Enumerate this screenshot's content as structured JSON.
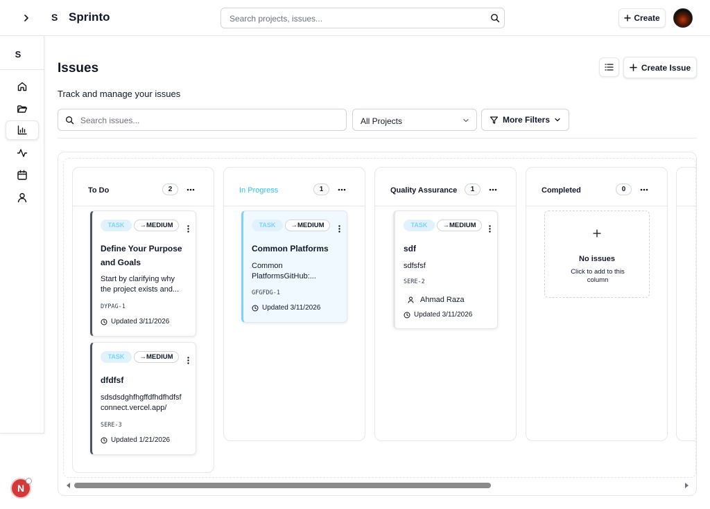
{
  "topbar": {
    "logo_letter": "S",
    "brand": "Sprinto",
    "search_placeholder": "Search projects, issues...",
    "create_label": "Create"
  },
  "sidebar": {
    "logo_letter": "S",
    "items": [
      {
        "icon": "home-icon"
      },
      {
        "icon": "folder-icon"
      },
      {
        "icon": "bar-chart-icon",
        "active": true
      },
      {
        "icon": "activity-icon"
      },
      {
        "icon": "calendar-icon"
      },
      {
        "icon": "user-icon"
      }
    ],
    "badge_letter": "N"
  },
  "page": {
    "title": "Issues",
    "subtitle": "Track and manage your issues",
    "create_issue_label": "Create Issue"
  },
  "filters": {
    "search_placeholder": "Search issues...",
    "project_select": "All Projects",
    "more_filters_label": "More Filters"
  },
  "board": {
    "columns": [
      {
        "title": "To Do",
        "count": "2",
        "cards": [
          {
            "type": "TASK",
            "priority": "→MEDIUM",
            "title_lines": [
              "Define Your Purpose",
              "and Goals"
            ],
            "desc_lines": [
              "Start by clarifying why",
              "the project exists and..."
            ],
            "key": "DYPAG-1",
            "updated": "Updated 3/11/2026"
          },
          {
            "type": "TASK",
            "priority": "→MEDIUM",
            "title_lines": [
              "dfdfsf"
            ],
            "desc_lines": [
              "sdsdsdghfhgffdfhdfhdfsf",
              "connect.vercel.app/"
            ],
            "key": "SERE-3",
            "updated": "Updated 1/21/2026"
          }
        ]
      },
      {
        "title": "In Progress",
        "count": "1",
        "cards": [
          {
            "type": "TASK",
            "priority": "→MEDIUM",
            "title_lines": [
              "Common Platforms"
            ],
            "desc_lines": [
              "Common",
              "PlatformsGitHub:..."
            ],
            "key": "GFGFDG-1",
            "updated": "Updated 3/11/2026"
          }
        ]
      },
      {
        "title": "Quality Assurance",
        "count": "1",
        "cards": [
          {
            "type": "TASK",
            "priority": "→MEDIUM",
            "title_lines": [
              "sdf"
            ],
            "desc_lines": [
              "sdfsfsf"
            ],
            "key": "SERE-2",
            "assignee": "Ahmad Raza",
            "updated": "Updated 3/11/2026"
          }
        ]
      },
      {
        "title": "Completed",
        "count": "0",
        "empty_title": "No issues",
        "empty_sub": "Click to add to this column"
      }
    ]
  },
  "colors": {
    "in_progress_title": "#38bdf8",
    "task_tag_bg": "#e0f2fe",
    "task_tag_text": "#7dd3fc",
    "card_accent_dark": "#4b5563",
    "card_accent_blue": "#7dd3fc",
    "badge_red": "#d23a3a"
  }
}
